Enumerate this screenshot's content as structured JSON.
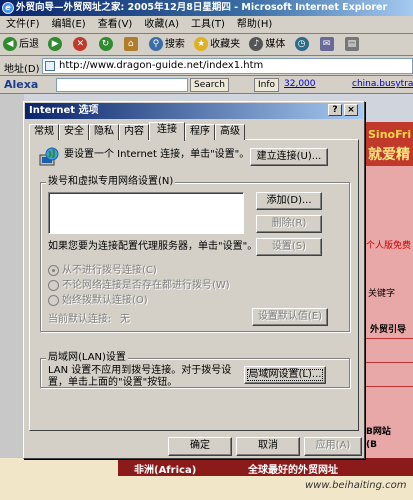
{
  "browser": {
    "title": "外贸向导—外贸网址之家: 2005年12月8日星期四 - Microsoft Internet Explorer",
    "menu": [
      "文件(F)",
      "编辑(E)",
      "查看(V)",
      "收藏(A)",
      "工具(T)",
      "帮助(H)"
    ],
    "toolbar": {
      "back": "后退",
      "search": "搜索",
      "favorites": "收藏夹",
      "media": "媒体"
    },
    "address_label": "地址(D)",
    "address_value": "http://www.dragon-guide.net/index1.htm",
    "alexa": {
      "brand": "Alexa",
      "search": "Search",
      "info": "Info",
      "rank": "32,000",
      "link": "china.busytrade"
    }
  },
  "page": {
    "banner_top": "SinoFri",
    "banner_bottom": "就爱精",
    "side_texts": [
      "个人版免费",
      "关键字",
      "外贸引导",
      "B网站",
      "(B"
    ],
    "bottom_left": "非洲(Africa)",
    "bottom_right": "全球最好的外贸网址",
    "watermark": "www.beihaiting.com"
  },
  "dialog": {
    "title": "Internet 选项",
    "help_btn": "?",
    "close_btn": "×",
    "tabs": [
      "常规",
      "安全",
      "隐私",
      "内容",
      "连接",
      "程序",
      "高级"
    ],
    "active_tab": "连接",
    "setup_text": "要设置一个 Internet 连接，单击\"设置\"。",
    "setup_button": "建立连接(U)...",
    "dialup_group": "拨号和虚拟专用网络设置(N)",
    "add_button": "添加(D)...",
    "remove_button": "删除(R)",
    "settings_button": "设置(S)",
    "proxy_text": "如果您要为连接配置代理服务器，单击\"设置\"。",
    "radio_never": "从不进行拨号连接(C)",
    "radio_when_no_net": "不论网络连接是否存在都进行拨号(W)",
    "radio_always": "始终拨默认连接(O)",
    "current_default_label": "当前默认连接:",
    "current_default_value": "无",
    "set_default_button": "设置默认值(E)",
    "lan_group": "局域网(LAN)设置",
    "lan_text_line1": "LAN 设置不应用到拨号连接。对于拨号设",
    "lan_text_line2": "置，单击上面的\"设置\"按钮。",
    "lan_button": "局域网设置(L)...",
    "ok_button": "确定",
    "cancel_button": "取消",
    "apply_button": "应用(A)"
  }
}
